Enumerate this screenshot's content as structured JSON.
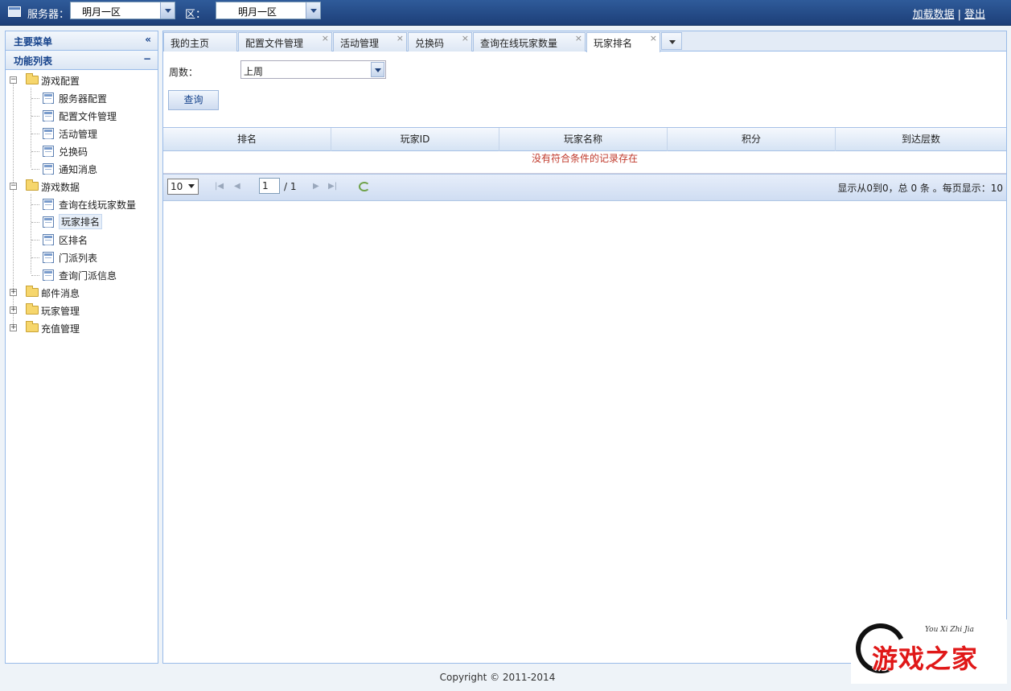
{
  "topbar": {
    "icon": "window-icon",
    "server_label": "服务器：",
    "server_value": "明月一区",
    "zone_label": "区：",
    "zone_value": "明月一区",
    "load_link": "加载数据",
    "separator": "|",
    "logout_link": "登出"
  },
  "sidebar": {
    "main_menu": "主要菜单",
    "collapse_icon": "«",
    "func_list": "功能列表",
    "minimize_icon": "−",
    "tree": [
      {
        "label": "游戏配置",
        "expanded": true,
        "children": [
          "服务器配置",
          "配置文件管理",
          "活动管理",
          "兑换码",
          "通知消息"
        ]
      },
      {
        "label": "游戏数据",
        "expanded": true,
        "children": [
          "查询在线玩家数量",
          "玩家排名",
          "区排名",
          "门派列表",
          "查询门派信息"
        ]
      },
      {
        "label": "邮件消息",
        "expanded": false,
        "children": []
      },
      {
        "label": "玩家管理",
        "expanded": false,
        "children": []
      },
      {
        "label": "充值管理",
        "expanded": false,
        "children": []
      }
    ],
    "selected": "玩家排名"
  },
  "tabs": [
    {
      "label": "我的主页",
      "closable": false
    },
    {
      "label": "配置文件管理",
      "closable": true
    },
    {
      "label": "活动管理",
      "closable": true
    },
    {
      "label": "兑换码",
      "closable": true
    },
    {
      "label": "查询在线玩家数量",
      "closable": true
    },
    {
      "label": "玩家排名",
      "closable": true,
      "active": true
    }
  ],
  "tab_close_glyph": "×",
  "form": {
    "week_label": "周数：",
    "week_value": "上周",
    "query_button": "查询"
  },
  "grid": {
    "columns": [
      "排名",
      "玩家ID",
      "玩家名称",
      "积分",
      "到达层数"
    ],
    "empty_message": "没有符合条件的记录存在"
  },
  "pager": {
    "page_size": "10",
    "first": "|◀",
    "prev": "◀",
    "current_page": "1",
    "of_pages": "/ 1",
    "next": "▶",
    "last": "▶|",
    "info": "显示从0到0，总 0 条 。每页显示：10"
  },
  "footer": {
    "copyright": "Copyright © 2011-2014"
  },
  "watermark": {
    "text": "游戏之家",
    "pinyin": "You Xi Zhi Jia"
  },
  "colors": {
    "topbar": "#1d3f78",
    "border": "#99bbe8",
    "empty_text": "#c0392b"
  }
}
